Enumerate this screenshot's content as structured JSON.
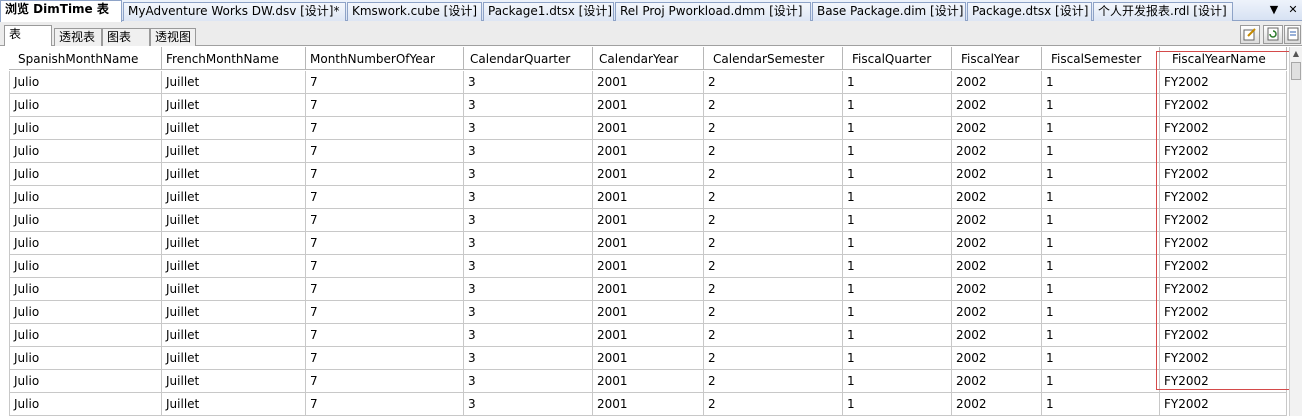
{
  "doc_tabs": [
    {
      "label": "浏览 DimTime 表",
      "active": true
    },
    {
      "label": "MyAdventure Works DW.dsv [设计]*",
      "active": false
    },
    {
      "label": "Kmswork.cube [设计]",
      "active": false
    },
    {
      "label": "Package1.dtsx [设计]",
      "active": false
    },
    {
      "label": "Rel Proj Pworkload.dmm [设计]",
      "active": false
    },
    {
      "label": "Base Package.dim [设计]",
      "active": false
    },
    {
      "label": "Package.dtsx [设计]",
      "active": false
    },
    {
      "label": "个人开发报表.rdl [设计]",
      "active": false
    }
  ],
  "tab_controls": {
    "menu": "▼",
    "close": "✕"
  },
  "view_tabs": [
    {
      "label": "表",
      "active": true
    },
    {
      "label": "透视表",
      "active": false
    },
    {
      "label": "图表",
      "active": false
    },
    {
      "label": "透视图",
      "active": false
    }
  ],
  "toolbar_icons": [
    "edit-icon",
    "refresh-icon",
    "export-icon"
  ],
  "columns": [
    "SpanishMonthName",
    "FrenchMonthName",
    "MonthNumberOfYear",
    "CalendarQuarter",
    "CalendarYear",
    "CalendarSemester",
    "FiscalQuarter",
    "FiscalYear",
    "FiscalSemester",
    "FiscalYearName"
  ],
  "rows": [
    [
      "Julio",
      "Juillet",
      "7",
      "3",
      "2001",
      "2",
      "1",
      "2002",
      "1",
      "FY2002"
    ],
    [
      "Julio",
      "Juillet",
      "7",
      "3",
      "2001",
      "2",
      "1",
      "2002",
      "1",
      "FY2002"
    ],
    [
      "Julio",
      "Juillet",
      "7",
      "3",
      "2001",
      "2",
      "1",
      "2002",
      "1",
      "FY2002"
    ],
    [
      "Julio",
      "Juillet",
      "7",
      "3",
      "2001",
      "2",
      "1",
      "2002",
      "1",
      "FY2002"
    ],
    [
      "Julio",
      "Juillet",
      "7",
      "3",
      "2001",
      "2",
      "1",
      "2002",
      "1",
      "FY2002"
    ],
    [
      "Julio",
      "Juillet",
      "7",
      "3",
      "2001",
      "2",
      "1",
      "2002",
      "1",
      "FY2002"
    ],
    [
      "Julio",
      "Juillet",
      "7",
      "3",
      "2001",
      "2",
      "1",
      "2002",
      "1",
      "FY2002"
    ],
    [
      "Julio",
      "Juillet",
      "7",
      "3",
      "2001",
      "2",
      "1",
      "2002",
      "1",
      "FY2002"
    ],
    [
      "Julio",
      "Juillet",
      "7",
      "3",
      "2001",
      "2",
      "1",
      "2002",
      "1",
      "FY2002"
    ],
    [
      "Julio",
      "Juillet",
      "7",
      "3",
      "2001",
      "2",
      "1",
      "2002",
      "1",
      "FY2002"
    ],
    [
      "Julio",
      "Juillet",
      "7",
      "3",
      "2001",
      "2",
      "1",
      "2002",
      "1",
      "FY2002"
    ],
    [
      "Julio",
      "Juillet",
      "7",
      "3",
      "2001",
      "2",
      "1",
      "2002",
      "1",
      "FY2002"
    ],
    [
      "Julio",
      "Juillet",
      "7",
      "3",
      "2001",
      "2",
      "1",
      "2002",
      "1",
      "FY2002"
    ],
    [
      "Julio",
      "Juillet",
      "7",
      "3",
      "2001",
      "2",
      "1",
      "2002",
      "1",
      "FY2002"
    ],
    [
      "Julio",
      "Juillet",
      "7",
      "3",
      "2001",
      "2",
      "1",
      "2002",
      "1",
      "FY2002"
    ]
  ],
  "highlighted_column": "FiscalYearName",
  "colors": {
    "highlight_border": "#d44a4a",
    "tab_border": "#8ea3c7"
  }
}
